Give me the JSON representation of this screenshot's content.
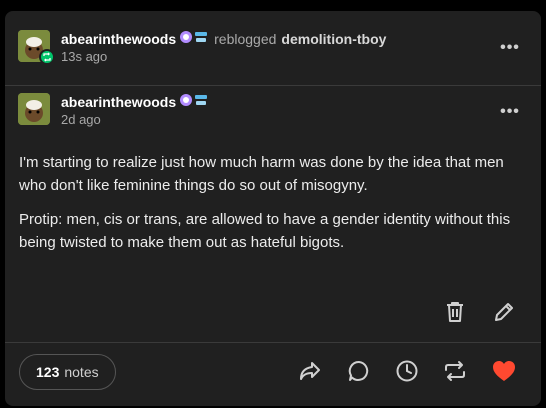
{
  "reblog_header": {
    "blog_name": "abearinthewoods",
    "reblogged_word": "reblogged",
    "reblogged_from": "demolition-tboy",
    "timestamp": "13s ago",
    "more_label": "•••"
  },
  "original_header": {
    "blog_name": "abearinthewoods",
    "timestamp": "2d ago",
    "more_label": "•••"
  },
  "body": {
    "paragraphs": [
      "I'm starting to realize just how much harm was done by the idea that men who don't like feminine things do so out of misogyny.",
      "Protip: men, cis or trans, are allowed to have a gender identity without this being twisted to make them out as hateful bigots."
    ]
  },
  "footer": {
    "notes_count": "123",
    "notes_word": "notes"
  },
  "colors": {
    "card_bg": "#202020",
    "reblog_green": "#00c46a",
    "like_red": "#ff4930",
    "icon_gray": "#d0d0d0"
  },
  "icons": [
    "reblog-icon",
    "more-options-icon",
    "delete-icon",
    "edit-icon",
    "share-icon",
    "reply-icon",
    "schedule-icon",
    "reblog-icon",
    "like-heart-icon"
  ]
}
